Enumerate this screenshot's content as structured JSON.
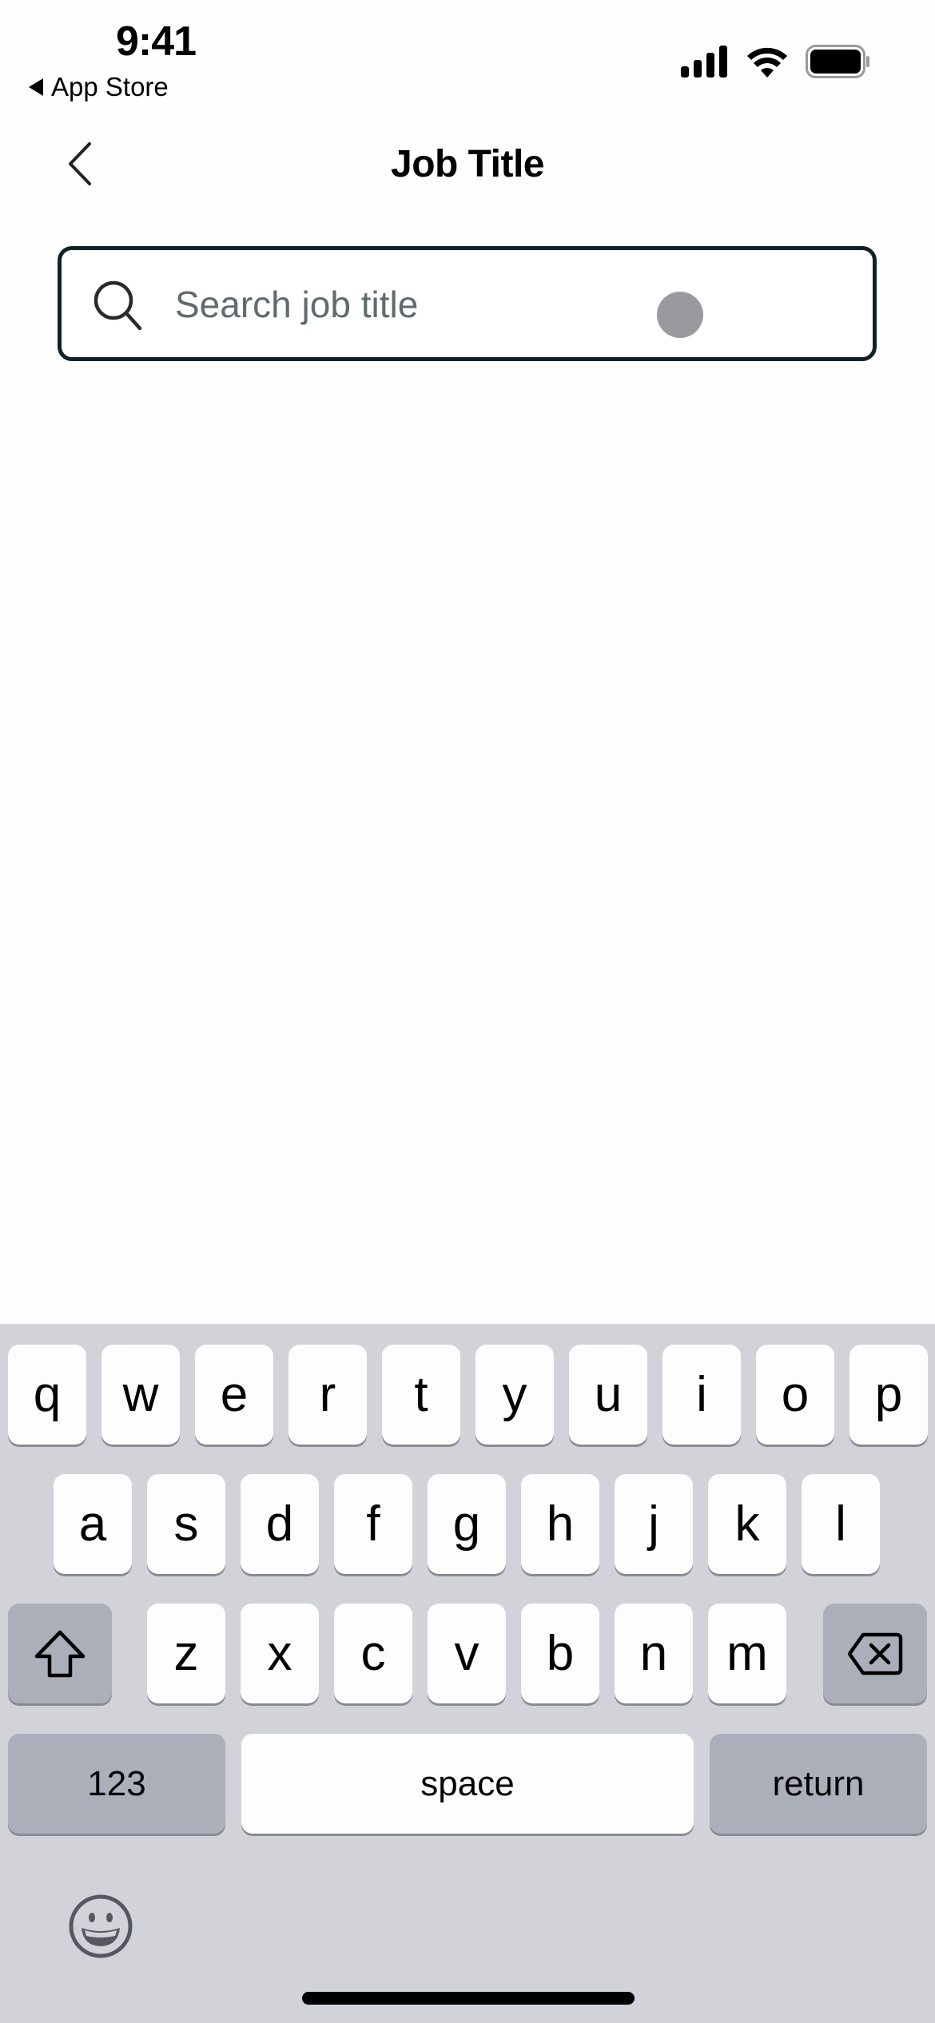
{
  "status_bar": {
    "time": "9:41",
    "back_app_label": "App Store",
    "icons": [
      "cellular-signal-icon",
      "wifi-icon",
      "battery-icon"
    ]
  },
  "nav": {
    "back_icon": "chevron-left-icon",
    "title": "Job Title"
  },
  "search": {
    "icon": "search-icon",
    "value": "",
    "placeholder": "Search job title",
    "border_color": "#0f2327",
    "placeholder_color": "#5f6b6c"
  },
  "keyboard": {
    "row1": [
      "q",
      "w",
      "e",
      "r",
      "t",
      "y",
      "u",
      "i",
      "o",
      "p"
    ],
    "row2": [
      "a",
      "s",
      "d",
      "f",
      "g",
      "h",
      "j",
      "k",
      "l"
    ],
    "row3": [
      "z",
      "x",
      "c",
      "v",
      "b",
      "n",
      "m"
    ],
    "shift_icon": "shift-icon",
    "delete_icon": "delete-backspace-icon",
    "numbers_label": "123",
    "space_label": "space",
    "return_label": "return",
    "emoji_icon": "emoji-icon",
    "background_color": "#d1d3d9"
  }
}
